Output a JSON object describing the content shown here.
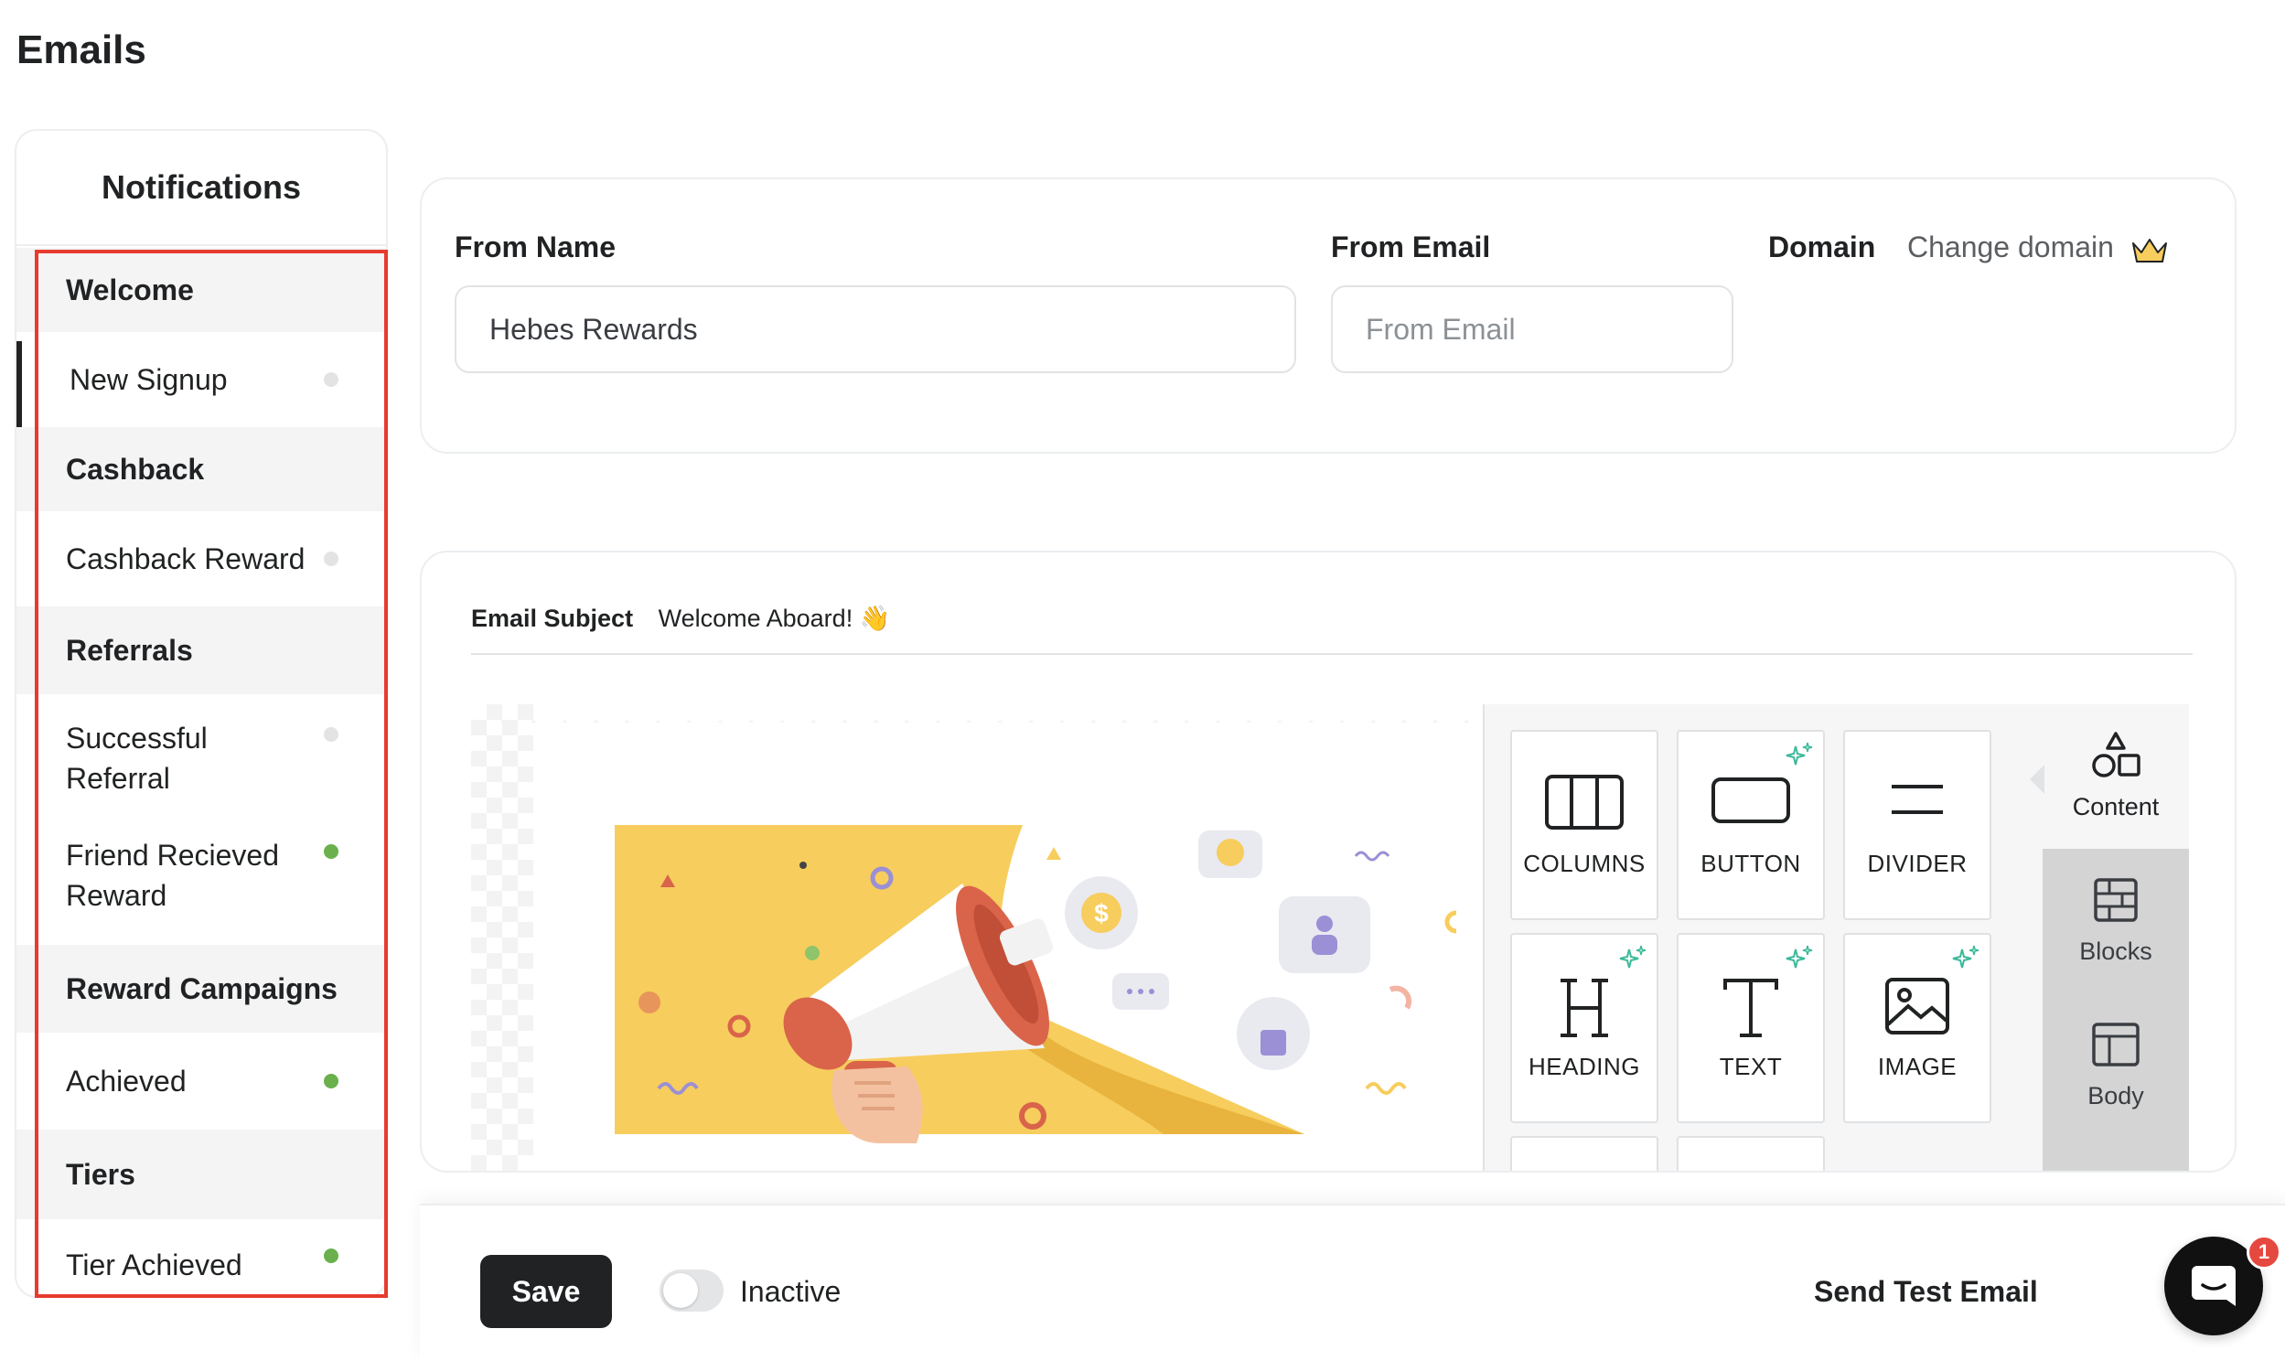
{
  "page": {
    "title": "Emails"
  },
  "sidebar": {
    "title": "Notifications",
    "items": [
      {
        "type": "group",
        "label": "Welcome"
      },
      {
        "type": "entry",
        "label": "New Signup",
        "status": "grey",
        "active": true
      },
      {
        "type": "group",
        "label": "Cashback"
      },
      {
        "type": "entry",
        "label": "Cashback Reward",
        "status": "grey"
      },
      {
        "type": "group",
        "label": "Referrals"
      },
      {
        "type": "entry",
        "label": "Successful Referral",
        "status": "grey"
      },
      {
        "type": "entry",
        "label": "Friend Recieved Reward",
        "status": "green"
      },
      {
        "type": "group",
        "label": "Reward Campaigns"
      },
      {
        "type": "entry",
        "label": "Achieved",
        "status": "green"
      },
      {
        "type": "group",
        "label": "Tiers"
      },
      {
        "type": "entry",
        "label": "Tier Achieved",
        "status": "green"
      }
    ]
  },
  "sender": {
    "from_name_label": "From Name",
    "from_name_value": "Hebes Rewards",
    "from_email_label": "From Email",
    "from_email_placeholder": "From Email",
    "domain_label": "Domain",
    "change_domain_label": "Change domain"
  },
  "editor": {
    "subject_label": "Email Subject",
    "subject_value": "Welcome Aboard! 👋",
    "tools": [
      {
        "name": "COLUMNS",
        "icon": "columns-icon",
        "ai": false
      },
      {
        "name": "BUTTON",
        "icon": "button-icon",
        "ai": true
      },
      {
        "name": "DIVIDER",
        "icon": "divider-icon",
        "ai": false
      },
      {
        "name": "HEADING",
        "icon": "heading-icon",
        "ai": true
      },
      {
        "name": "TEXT",
        "icon": "text-icon",
        "ai": true
      },
      {
        "name": "IMAGE",
        "icon": "image-icon",
        "ai": true
      }
    ],
    "tabs": [
      {
        "label": "Content",
        "icon": "shapes-icon",
        "active": true
      },
      {
        "label": "Blocks",
        "icon": "blocks-icon",
        "active": false
      },
      {
        "label": "Body",
        "icon": "layout-icon",
        "active": false
      }
    ]
  },
  "bottom_bar": {
    "save_label": "Save",
    "toggle_label": "Inactive",
    "send_test_label": "Send Test Email"
  },
  "chat": {
    "badge_count": "1"
  },
  "colors": {
    "status_grey": "#e3e3e3",
    "status_green": "#6ab04c",
    "highlight_red": "#e63b2e",
    "hero_yellow": "#f7cd5d",
    "megaphone_orange": "#d9644a",
    "ai_spark": "#3cb99a"
  }
}
